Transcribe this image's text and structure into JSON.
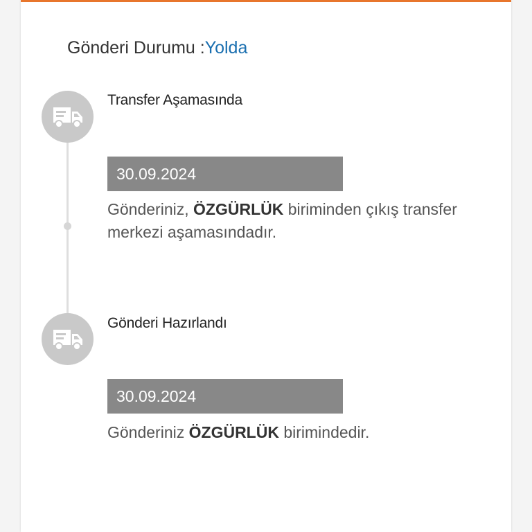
{
  "colors": {
    "accent_top": "#e8762c",
    "status_value": "#1a6fb0",
    "icon_circle": "#c9c9c9",
    "date_bar": "#888888"
  },
  "header": {
    "label": "Gönderi Durumu :",
    "value": "Yolda"
  },
  "timeline": [
    {
      "icon": "delivery-truck-icon",
      "title": "Transfer Aşamasında",
      "date": "30.09.2024",
      "desc_prefix": "Gönderiniz, ",
      "desc_bold": "ÖZGÜRLÜK",
      "desc_suffix": " biriminden çıkış transfer merkezi aşamasındadır."
    },
    {
      "icon": "delivery-truck-icon",
      "title": "Gönderi Hazırlandı",
      "date": "30.09.2024",
      "desc_prefix": "Gönderiniz ",
      "desc_bold": "ÖZGÜRLÜK",
      "desc_suffix": " birimindedir."
    }
  ]
}
